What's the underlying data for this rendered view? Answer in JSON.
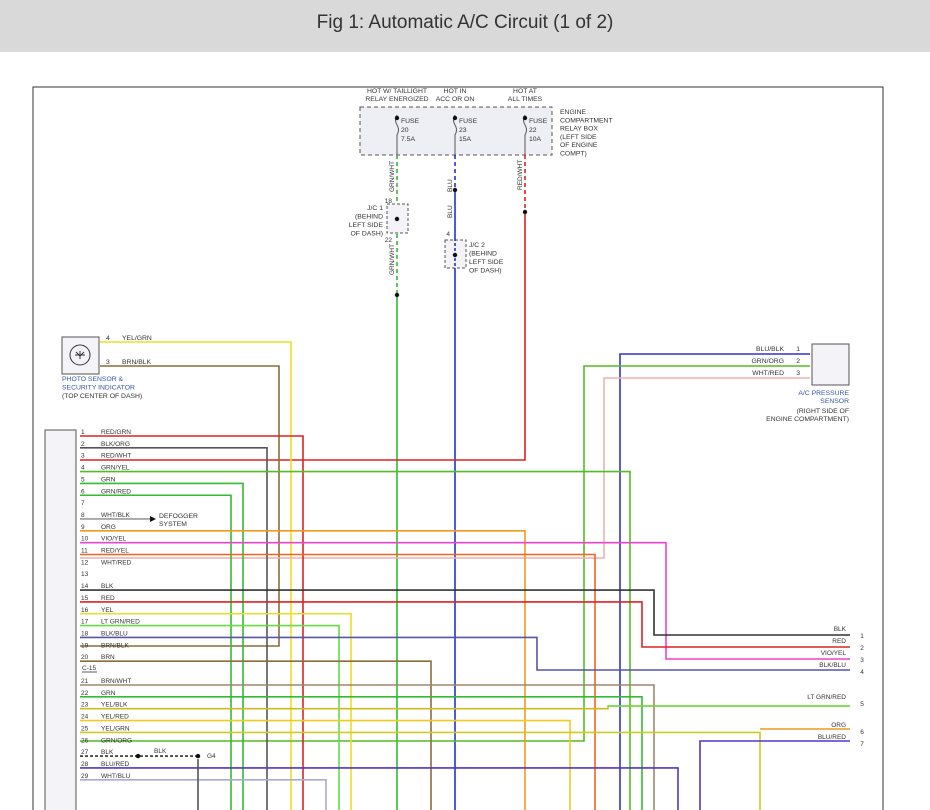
{
  "page": {
    "title": "Fig 1: Automatic A/C Circuit (1 of 2)"
  },
  "fuses": [
    {
      "hot_lines": [
        "HOT W/ TAILLIGHT",
        "RELAY ENERGIZED"
      ],
      "label": "FUSE",
      "number": "20",
      "rating": "7.5A",
      "wire": "GRN/WHT",
      "color": "#33bb33"
    },
    {
      "hot_lines": [
        "HOT IN",
        "ACC OR ON"
      ],
      "label": "FUSE",
      "number": "23",
      "rating": "15A",
      "wire": "BLU",
      "color": "#2233cc"
    },
    {
      "hot_lines": [
        "HOT AT",
        "ALL TIMES"
      ],
      "label": "FUSE",
      "number": "22",
      "rating": "10A",
      "wire": "RED/WHT",
      "color": "#dd2222"
    }
  ],
  "relay_box": {
    "lines": [
      "ENGINE",
      "COMPARTMENT",
      "RELAY BOX",
      "(LEFT SIDE",
      "OF ENGINE",
      "COMPT)"
    ]
  },
  "jc1": {
    "lines": [
      "J/C 1",
      "(BEHIND",
      "LEFT SIDE",
      "OF DASH)"
    ],
    "pin_in": "18",
    "pin_out": "22",
    "wire_out": "GRN/WHT"
  },
  "jc2": {
    "lines": [
      "J/C 2",
      "(BEHIND",
      "LEFT SIDE",
      "OF DASH)"
    ],
    "pin_in": "4",
    "wire_in": "BLU"
  },
  "photo_sensor": {
    "lines": [
      "PHOTO SENSOR &",
      "SECURITY INDICATOR",
      "(TOP CENTER OF DASH)"
    ],
    "pins": [
      {
        "pin": "4",
        "wire": "YEL/GRN"
      },
      {
        "pin": "3",
        "wire": "BRN/BLK"
      }
    ]
  },
  "ac_sensor": {
    "lines": [
      "A/C PRESSURE",
      "SENSOR",
      "(RIGHT SIDE OF",
      "ENGINE COMPARTMENT)"
    ],
    "pins": [
      {
        "pin": "1",
        "wire": "BLU/BLK"
      },
      {
        "pin": "2",
        "wire": "GRN/ORG"
      },
      {
        "pin": "3",
        "wire": "WHT/RED"
      }
    ]
  },
  "defogger": {
    "lines": [
      "DEFOGGER",
      "SYSTEM"
    ]
  },
  "connector_label": "C-15",
  "ground": {
    "wire": "BLK",
    "label": "G4"
  },
  "module_pins": [
    {
      "pin": "1",
      "wire": "RED/GRN",
      "color": "#dd2222"
    },
    {
      "pin": "2",
      "wire": "BLK/ORG",
      "color": "#555555"
    },
    {
      "pin": "3",
      "wire": "RED/WHT",
      "color": "#dd2222"
    },
    {
      "pin": "4",
      "wire": "GRN/YEL",
      "color": "#55bb22"
    },
    {
      "pin": "5",
      "wire": "GRN",
      "color": "#33bb33"
    },
    {
      "pin": "6",
      "wire": "GRN/RED",
      "color": "#33bb33"
    },
    {
      "pin": "7",
      "wire": "",
      "color": ""
    },
    {
      "pin": "8",
      "wire": "WHT/BLK",
      "color": "#999999"
    },
    {
      "pin": "9",
      "wire": "ORG",
      "color": "#ee9922"
    },
    {
      "pin": "10",
      "wire": "VIO/YEL",
      "color": "#ee44cc"
    },
    {
      "pin": "11",
      "wire": "RED/YEL",
      "color": "#ee6622"
    },
    {
      "pin": "12",
      "wire": "WHT/RED",
      "color": "#f0b0b0"
    },
    {
      "pin": "13",
      "wire": "",
      "color": ""
    },
    {
      "pin": "14",
      "wire": "BLK",
      "color": "#333333"
    },
    {
      "pin": "15",
      "wire": "RED",
      "color": "#dd2222"
    },
    {
      "pin": "16",
      "wire": "YEL",
      "color": "#eedd22"
    },
    {
      "pin": "17",
      "wire": "LT GRN/RED",
      "color": "#66dd44"
    },
    {
      "pin": "18",
      "wire": "BLK/BLU",
      "color": "#5555aa"
    },
    {
      "pin": "19",
      "wire": "BRN/BLK",
      "color": "#8a6d3b"
    },
    {
      "pin": "20",
      "wire": "BRN",
      "color": "#8a6d3b"
    },
    {
      "pin": "21",
      "wire": "BRN/WHT",
      "color": "#a0856a"
    },
    {
      "pin": "22",
      "wire": "GRN",
      "color": "#33bb33"
    },
    {
      "pin": "23",
      "wire": "YEL/BLK",
      "color": "#ccbb22"
    },
    {
      "pin": "24",
      "wire": "YEL/RED",
      "color": "#eecc22"
    },
    {
      "pin": "25",
      "wire": "YEL/GRN",
      "color": "#cccc22"
    },
    {
      "pin": "26",
      "wire": "GRN/ORG",
      "color": "#55aa33"
    },
    {
      "pin": "27",
      "wire": "BLK",
      "color": "#333333"
    },
    {
      "pin": "28",
      "wire": "BLU/RED",
      "color": "#5533cc"
    },
    {
      "pin": "29",
      "wire": "WHT/BLU",
      "color": "#aaaacc"
    }
  ],
  "right_terminals": [
    {
      "pin": "1",
      "wire": "BLK"
    },
    {
      "pin": "2",
      "wire": "RED"
    },
    {
      "pin": "3",
      "wire": "VIO/YEL"
    },
    {
      "pin": "4",
      "wire": "BLK/BLU"
    },
    {
      "pin": "5",
      "wire": "LT GRN/RED"
    },
    {
      "pin": "6",
      "wire": "ORG"
    },
    {
      "pin": "7",
      "wire": "BLU/RED"
    }
  ]
}
